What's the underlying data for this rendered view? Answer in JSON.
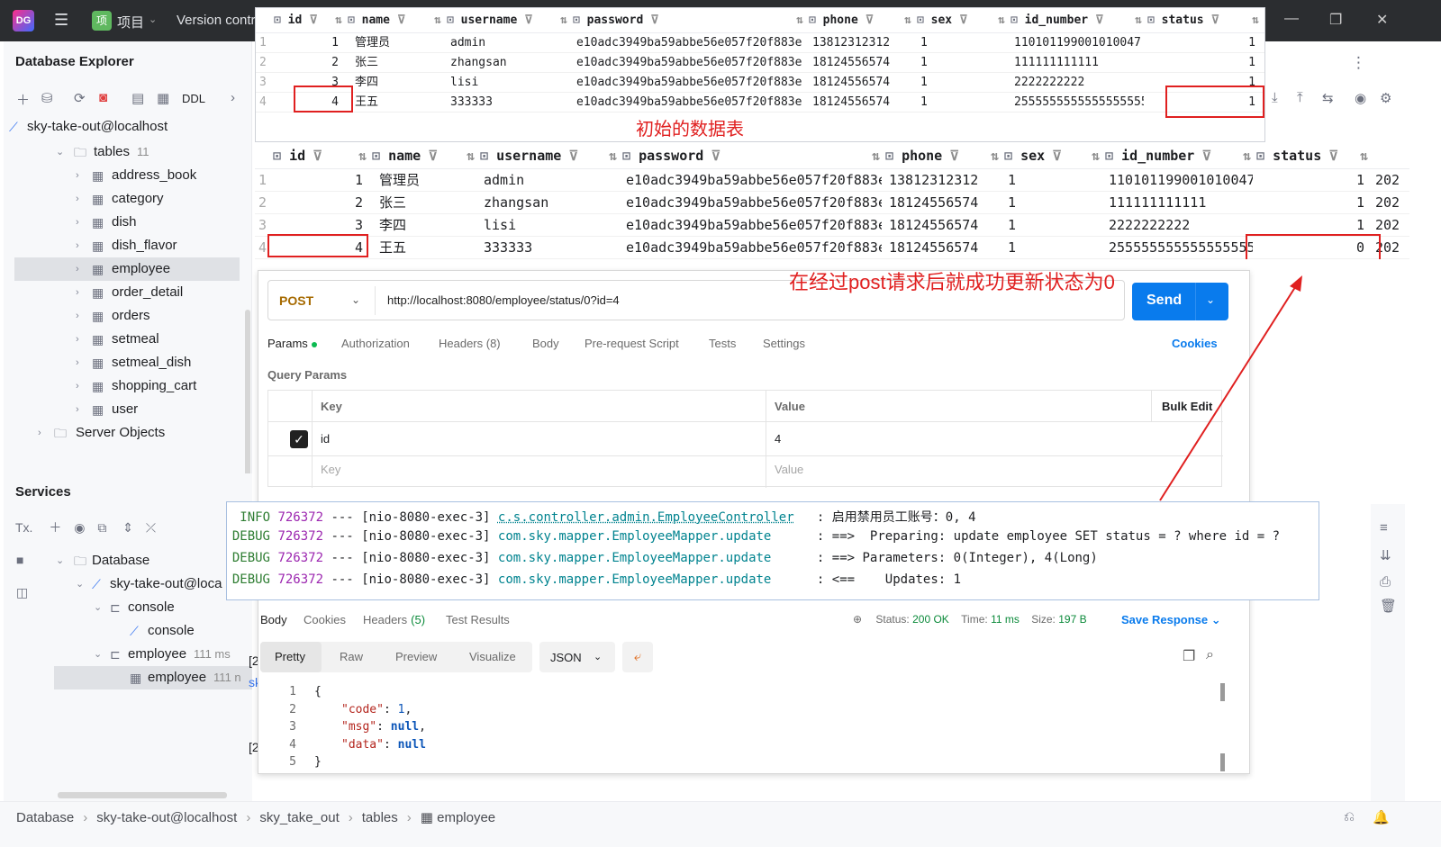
{
  "titlebar": {
    "app_icon": "DG",
    "project_badge": "项",
    "project_label": "项目",
    "vcs_label": "Version contr"
  },
  "explorer": {
    "title": "Database Explorer",
    "ddl_label": "DDL",
    "datasource": "sky-take-out@localhost",
    "tables_label": "tables",
    "tables_count": "11",
    "tables": [
      "address_book",
      "category",
      "dish",
      "dish_flavor",
      "employee",
      "order_detail",
      "orders",
      "setmeal",
      "setmeal_dish",
      "shopping_cart",
      "user"
    ],
    "selected_table": "employee",
    "server_objects": "Server Objects"
  },
  "services": {
    "title": "Services",
    "tx_label": "Tx.",
    "database": "Database",
    "datasource": "sky-take-out@loca",
    "console_group": "console",
    "console_item": "console",
    "employee_group": "employee",
    "employee_group_time": "111 ms",
    "employee_item": "employee",
    "employee_item_time": "111 n"
  },
  "columns": [
    "id",
    "name",
    "username",
    "password",
    "phone",
    "sex",
    "id_number",
    "status"
  ],
  "table_initial": {
    "rows": [
      [
        "1",
        "管理员",
        "admin",
        "e10adc3949ba59abbe56e057f20f883e",
        "13812312312",
        "1",
        "110101199001010047",
        "1"
      ],
      [
        "2",
        "张三",
        "zhangsan",
        "e10adc3949ba59abbe56e057f20f883e",
        "18124556574",
        "1",
        "111111111111",
        "1"
      ],
      [
        "3",
        "李四",
        "lisi",
        "e10adc3949ba59abbe56e057f20f883e",
        "18124556574",
        "1",
        "2222222222",
        "1"
      ],
      [
        "4",
        "王五",
        "333333",
        "e10adc3949ba59abbe56e057f20f883e",
        "18124556574",
        "1",
        "2555555555555555555",
        "1"
      ]
    ],
    "note": "初始的数据表"
  },
  "table_updated": {
    "rows": [
      [
        "1",
        "管理员",
        "admin",
        "e10adc3949ba59abbe56e057f20f883e",
        "13812312312",
        "1",
        "110101199001010047",
        "1",
        "202"
      ],
      [
        "2",
        "张三",
        "zhangsan",
        "e10adc3949ba59abbe56e057f20f883e",
        "18124556574",
        "1",
        "111111111111",
        "1",
        "202"
      ],
      [
        "3",
        "李四",
        "lisi",
        "e10adc3949ba59abbe56e057f20f883e",
        "18124556574",
        "1",
        "2222222222",
        "1",
        "202"
      ],
      [
        "4",
        "王五",
        "333333",
        "e10adc3949ba59abbe56e057f20f883e",
        "18124556574",
        "1",
        "2555555555555555555",
        "0",
        "202"
      ]
    ]
  },
  "annotation_note": "在经过post请求后就成功更新状态为0",
  "postman": {
    "method": "POST",
    "url": "http://localhost:8080/employee/status/0?id=4",
    "send_label": "Send",
    "tabs": [
      "Params",
      "Authorization",
      "Headers (8)",
      "Body",
      "Pre-request Script",
      "Tests",
      "Settings"
    ],
    "cookies_label": "Cookies",
    "query_params_label": "Query Params",
    "qp_header_key": "Key",
    "qp_header_value": "Value",
    "qp_bulk_edit": "Bulk Edit",
    "qp_row_key": "id",
    "qp_row_value": "4",
    "qp_placeholder_key": "Key",
    "qp_placeholder_value": "Value",
    "response_tabs": [
      "Body",
      "Cookies",
      "Headers",
      "Test Results"
    ],
    "response_headers_count": "(5)",
    "status_label": "Status:",
    "status_value": "200 OK",
    "time_label": "Time:",
    "time_value": "11 ms",
    "size_label": "Size:",
    "size_value": "197 B",
    "save_response": "Save Response",
    "view_tabs": [
      "Pretty",
      "Raw",
      "Preview",
      "Visualize"
    ],
    "format": "JSON",
    "code_lines": [
      "1",
      "2",
      "3",
      "4",
      "5"
    ],
    "response": {
      "open": "{",
      "k1": "\"code\"",
      "v1": "1",
      "k2": "\"msg\"",
      "v2": "null",
      "k3": "\"data\"",
      "v3": "null",
      "close": "}"
    }
  },
  "log": [
    {
      "level": "INFO",
      "pid": "726372",
      "sep": "---",
      "thread": "[nio-8080-exec-3]",
      "cls": "c.s.controller.admin.EmployeeController",
      "msg": ": 启用禁用员工账号：0, 4"
    },
    {
      "level": "DEBUG",
      "pid": "726372",
      "sep": "---",
      "thread": "[nio-8080-exec-3]",
      "cls": "com.sky.mapper.EmployeeMapper.update",
      "msg": ": ==>  Preparing: update employee SET status = ? where id = ?"
    },
    {
      "level": "DEBUG",
      "pid": "726372",
      "sep": "---",
      "thread": "[nio-8080-exec-3]",
      "cls": "com.sky.mapper.EmployeeMapper.update",
      "msg": ": ==> Parameters: 0(Integer), 4(Long)"
    },
    {
      "level": "DEBUG",
      "pid": "726372",
      "sep": "---",
      "thread": "[nio-8080-exec-3]",
      "cls": "com.sky.mapper.EmployeeMapper.update",
      "msg": ": <==    Updates: 1"
    }
  ],
  "breadcrumbs": [
    "Database",
    "sky-take-out@localhost",
    "sky_take_out",
    "tables",
    "employee"
  ],
  "colors": {
    "accent": "#097bed",
    "red": "#e02020",
    "method": "#a66a00",
    "ok": "#0b8a3a"
  }
}
